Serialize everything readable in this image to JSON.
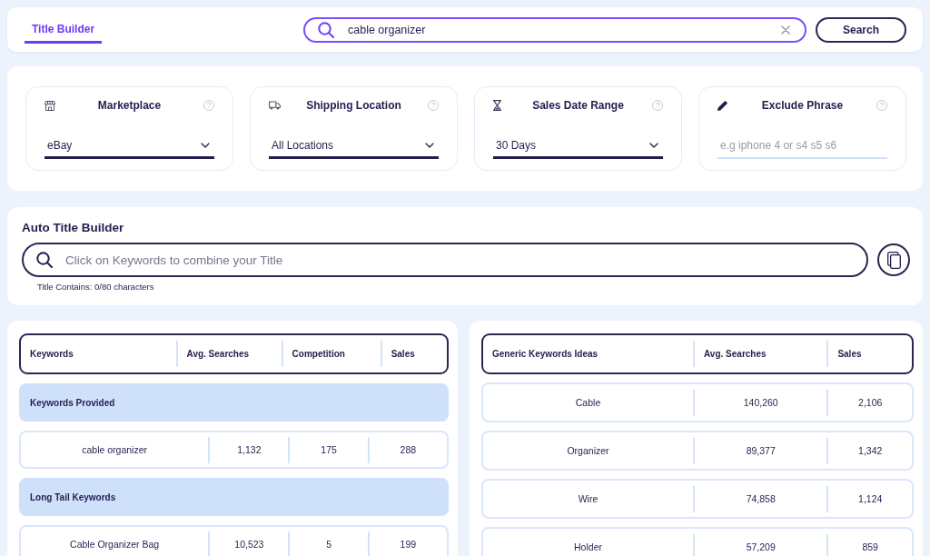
{
  "nav": {
    "tabs": [
      {
        "label": "Title Builder",
        "selected": true
      }
    ]
  },
  "search": {
    "value": "cable organizer",
    "button": "Search"
  },
  "filters": [
    {
      "kind": "select",
      "title": "Marketplace",
      "value": "eBay"
    },
    {
      "kind": "select",
      "title": "Shipping Location",
      "value": "All Locations"
    },
    {
      "kind": "select",
      "title": "Sales Date Range",
      "value": "30 Days"
    },
    {
      "kind": "input",
      "title": "Exclude Phrase",
      "placeholder": "e.g iphone 4 or s4 s5 s6"
    }
  ],
  "auto_title_builder": {
    "title": "Auto Title Builder",
    "placeholder": "Click on Keywords to combine your Title",
    "counter": "Title Contains: 0/80 characters"
  },
  "keywords_table": {
    "columns": [
      "Keywords",
      "Avg. Searches",
      "Competition",
      "Sales"
    ],
    "rows": [
      {
        "kind": "group",
        "label": "Keywords Provided"
      },
      {
        "kind": "data",
        "cells": [
          "cable organizer",
          "1,132",
          "175",
          "288"
        ]
      },
      {
        "kind": "group",
        "label": "Long Tail Keywords"
      },
      {
        "kind": "data",
        "cells": [
          "Cable Organizer Bag",
          "10,523",
          "5",
          "199"
        ]
      }
    ]
  },
  "generic_table": {
    "columns": [
      "Generic Keywords Ideas",
      "Avg. Searches",
      "Sales"
    ],
    "rows": [
      {
        "kind": "data",
        "cells": [
          "Cable",
          "140,260",
          "2,106"
        ]
      },
      {
        "kind": "data",
        "cells": [
          "Organizer",
          "89,377",
          "1,342"
        ]
      },
      {
        "kind": "data",
        "cells": [
          "Wire",
          "74,858",
          "1,124"
        ]
      },
      {
        "kind": "data",
        "cells": [
          "Holder",
          "57,209",
          "859"
        ]
      }
    ]
  }
}
